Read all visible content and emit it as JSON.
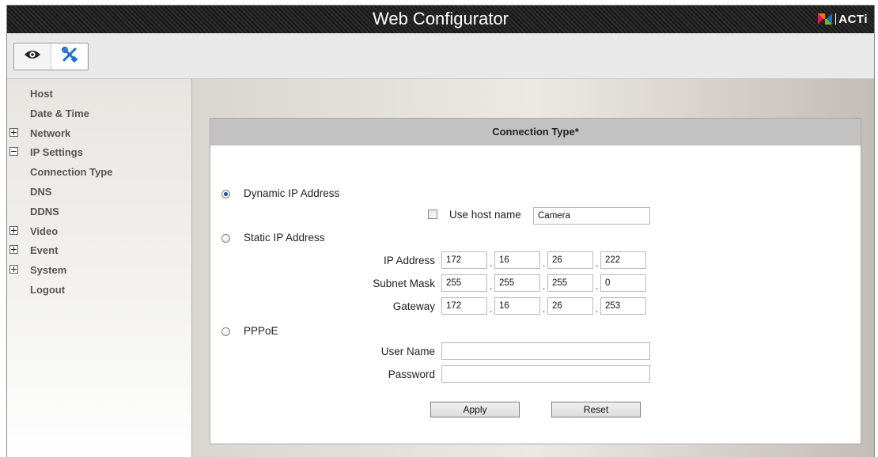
{
  "header": {
    "title": "Web Configurator",
    "logo_text": "ACTi"
  },
  "toolbar": {
    "live_view_icon": "eye-icon",
    "setup_icon": "tools-icon"
  },
  "sidebar": {
    "items": [
      {
        "label": "Host",
        "toggle": ""
      },
      {
        "label": "Date & Time",
        "toggle": ""
      },
      {
        "label": "Network",
        "toggle": "plus"
      },
      {
        "label": "IP Settings",
        "toggle": "minus"
      },
      {
        "label": "Connection Type",
        "toggle": ""
      },
      {
        "label": "DNS",
        "toggle": ""
      },
      {
        "label": "DDNS",
        "toggle": ""
      },
      {
        "label": "Video",
        "toggle": "plus"
      },
      {
        "label": "Event",
        "toggle": "plus"
      },
      {
        "label": "System",
        "toggle": "plus"
      },
      {
        "label": "Logout",
        "toggle": ""
      }
    ]
  },
  "panel": {
    "title": "Connection Type*",
    "dynamic": {
      "label": "Dynamic IP Address",
      "selected": true
    },
    "use_host_name": {
      "label": "Use host name",
      "checked": false,
      "value": "Camera"
    },
    "static": {
      "label": "Static IP Address",
      "selected": false,
      "ip_address": {
        "label": "IP Address",
        "octets": [
          "172",
          "16",
          "26",
          "222"
        ]
      },
      "subnet_mask": {
        "label": "Subnet Mask",
        "octets": [
          "255",
          "255",
          "255",
          "0"
        ]
      },
      "gateway": {
        "label": "Gateway",
        "octets": [
          "172",
          "16",
          "26",
          "253"
        ]
      }
    },
    "pppoe": {
      "label": "PPPoE",
      "selected": false,
      "user_name": {
        "label": "User Name",
        "value": ""
      },
      "password": {
        "label": "Password",
        "value": ""
      }
    },
    "apply_label": "Apply",
    "reset_label": "Reset",
    "octet_separator": "."
  },
  "colors": {
    "header_bg": "#222222",
    "sidebar_text": "#555555",
    "panel_header_bg": "#c2c2c2",
    "logo_red": "#e5173f",
    "logo_blue": "#1e6fc8"
  }
}
